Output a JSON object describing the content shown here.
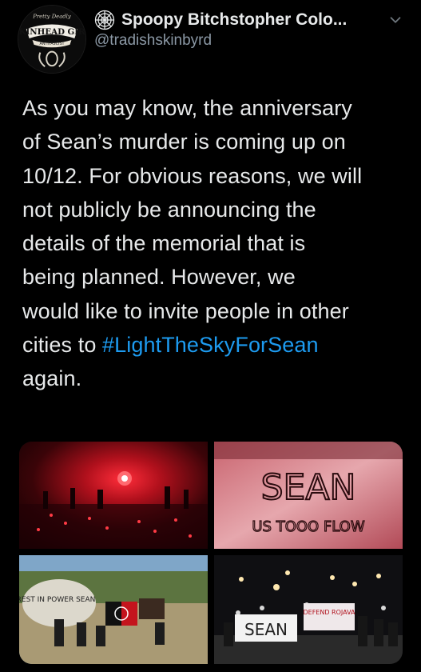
{
  "header": {
    "display_name": "Spoopy Bitchstopher Colo...",
    "handle": "@tradishskinbyrd",
    "verified_icon": "spider-web-icon",
    "menu_icon": "chevron-down-icon"
  },
  "avatar": {
    "script_text": "Pretty Deadly",
    "main_text": "SKINHEAD GIRL",
    "ribbon_text": "ANTIFASCIST"
  },
  "tweet": {
    "line1": "As you may know, the anniversary",
    "line2": "of Sean’s murder is coming up on",
    "line3": "10/12. For obvious reasons, we will",
    "line4": "not publicly be announcing the",
    "line5": "details of the memorial that is",
    "line6": "being planned. However, we",
    "line7": "would like to invite people in other",
    "line8_prefix": "cities to ",
    "hashtag": "#LightTheSkyForSean",
    "line9": "again."
  },
  "media": {
    "photo2_text": "SEAN",
    "photo2_sub": "US TOOO FLOW",
    "photo3_text": "REST IN POWER SEAN",
    "photo4_banner1": "SEAN",
    "photo4_banner2": "DEFEND ROJAVA"
  },
  "colors": {
    "background": "#000000",
    "text": "#e7e9ea",
    "secondary": "#8b98a5",
    "link": "#1d9bf0"
  }
}
